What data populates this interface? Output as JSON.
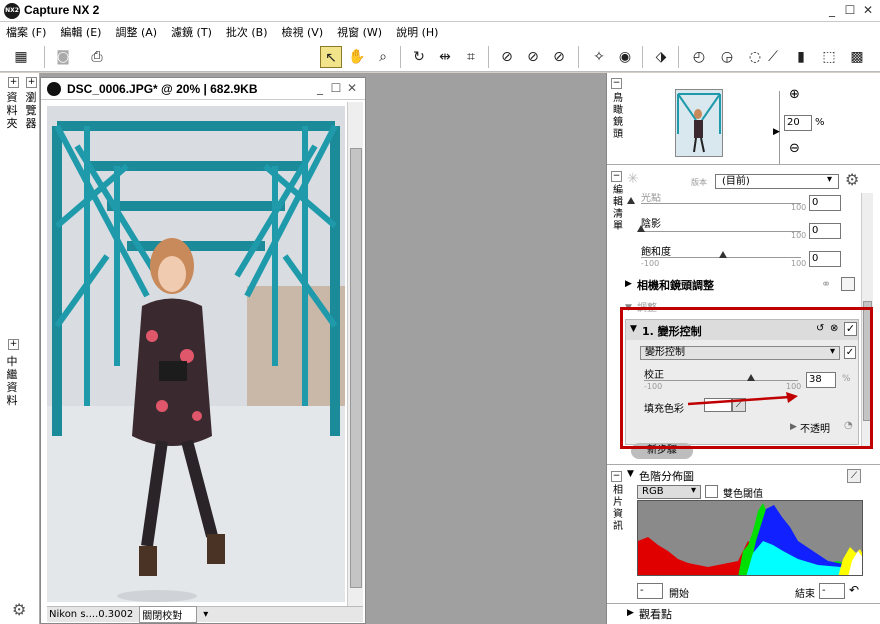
{
  "app": {
    "title": "Capture NX 2",
    "logo": "NX2"
  },
  "menu": [
    "檔案 (F)",
    "編輯 (E)",
    "調整 (A)",
    "濾鏡 (T)",
    "批次 (B)",
    "檢視 (V)",
    "視窗 (W)",
    "說明 (H)"
  ],
  "left_tabs": {
    "browser": "瀏覽器",
    "folders": "資料夾",
    "metadata": "中繼資料"
  },
  "document": {
    "title": "DSC_0006.JPG* @ 20% | 682.9KB",
    "status_camera": "Nikon s....0.3002",
    "status_mode": "關閉校對"
  },
  "navigator": {
    "label": "鳥瞰鏡頭",
    "zoom_value": "20",
    "zoom_unit": "%"
  },
  "edit_list": {
    "label": "編輯清單",
    "version_label": "版本",
    "version_value": "(目前)",
    "truncated_label": "光點",
    "rows": [
      {
        "label": "陰影",
        "min": "",
        "max": "100",
        "value": "0"
      },
      {
        "label": "飽和度",
        "min": "-100",
        "max": "100",
        "value": "0"
      }
    ],
    "top_row_max": "100",
    "top_row_value": "0",
    "camera_lens": "相機和鏡頭調整",
    "adjust": "調整",
    "step": {
      "title": "1. 變形控制",
      "dropdown": "變形控制",
      "correction_label": "校正",
      "min": "-100",
      "max": "100",
      "value": "38",
      "unit": "%",
      "fill_label": "填充色彩",
      "opacity_label": "不透明"
    },
    "new_step": "新步驟"
  },
  "histogram": {
    "label": "相片資訊",
    "title": "色階分佈圖",
    "channel": "RGB",
    "dual": "雙色閾值",
    "start_label": "開始",
    "end_label": "結束",
    "start_value": "-",
    "end_value": "-"
  },
  "watch_points": "觀看點",
  "colors": {
    "accent_red": "#c00000",
    "workspace": "#a0a0a0",
    "panel": "#ffffff"
  }
}
